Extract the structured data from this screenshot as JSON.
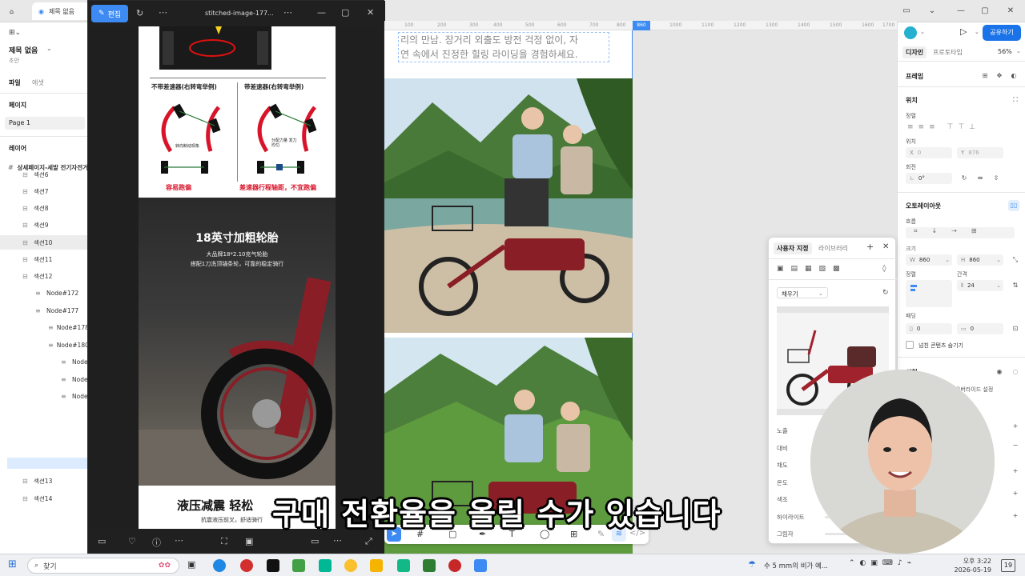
{
  "browser": {
    "home_icon": "home-icon",
    "tab_title": "제목 없음"
  },
  "viewer": {
    "edit_label": "편집",
    "file_name": "stitched-image-177...",
    "image": {
      "diagram_left_title": "不带差速器(右转弯举例)",
      "diagram_right_title": "带差速器(右转弯举例)",
      "diagram_left_inner": "转向制动现象",
      "diagram_right_inner": "分配力量 发力均匀",
      "diagram_left_caption": "容易跑偏",
      "diagram_right_caption": "差速器行程轴距，不宜跑偏",
      "tire_title": "18英寸加粗轮胎",
      "tire_sub1": "大品牌18*2.10充气轮胎",
      "tire_sub2": "搭配1刀洗顶锚条轮，可靠的稳定骑行",
      "bottom_title": "液压减震 轻松",
      "bottom_sub": "抗震液压前叉，舒适骑行"
    }
  },
  "left_panel": {
    "file_title": "제목 없음",
    "file_sub": "초안",
    "tabs": [
      "파일",
      "에셋"
    ],
    "pages_label": "페이지",
    "page_item": "Page 1",
    "layers_label": "레이어",
    "root_layer": "상세페이지-세발 전기자전거",
    "layers": [
      {
        "label": "섹션6",
        "indent": 0
      },
      {
        "label": "섹션7",
        "indent": 0
      },
      {
        "label": "섹션8",
        "indent": 0
      },
      {
        "label": "섹션9",
        "indent": 0
      },
      {
        "label": "섹션10",
        "indent": 0
      },
      {
        "label": "섹션11",
        "indent": 0
      },
      {
        "label": "섹션12",
        "indent": 0
      },
      {
        "label": "Node#172",
        "indent": 1
      },
      {
        "label": "Node#177",
        "indent": 1
      },
      {
        "label": "Node#178",
        "indent": 2
      },
      {
        "label": "Node#180",
        "indent": 2
      },
      {
        "label": "Node",
        "indent": 3
      },
      {
        "label": "Node",
        "indent": 3
      },
      {
        "label": "Node",
        "indent": 3
      },
      {
        "label": "섹션13",
        "indent": 0
      },
      {
        "label": "섹션14",
        "indent": 0
      }
    ]
  },
  "canvas": {
    "ruler_ticks": [
      "100",
      "200",
      "300",
      "400",
      "500",
      "600",
      "700",
      "800",
      "860",
      "1000",
      "1100",
      "1200",
      "1300",
      "1400",
      "1500",
      "1600",
      "1700"
    ],
    "text_line1": "리의 만남. 장거리 외출도 방전 걱정 없이, 자",
    "text_line2": "연 속에서 진정한 힐링 라이딩을 경험하세요."
  },
  "right_panel": {
    "share_label": "공유하기",
    "tabs": [
      "디자인",
      "프로토타입"
    ],
    "zoom": "56%",
    "frame_label": "프레임",
    "position_label": "위치",
    "align_label": "정렬",
    "pos_label": "위치",
    "x_value": "0",
    "y_value": "876",
    "rotation_label": "회전",
    "rotation_value": "0°",
    "autolayout_label": "오토레이아웃",
    "flow_label": "흐름",
    "size_label": "크기",
    "w_value": "860",
    "h_value": "860",
    "align2_label": "정렬",
    "gap_label": "간격",
    "gap_value": "24",
    "padding_label": "패딩",
    "pad_h": "0",
    "pad_v": "0",
    "clip_label": "넘친 콘텐츠 숨기기",
    "appearance_label": "외형",
    "fill_label": "오버라이드 설정"
  },
  "float_panel": {
    "tab_custom": "사용자 지정",
    "tab_library": "라이브러리",
    "fill_select": "채우기",
    "adjustments": [
      "노출",
      "대비",
      "채도",
      "온도",
      "색조",
      "하이라이트",
      "그림자"
    ]
  },
  "subtitle": "구매 전환율을 올릴 수가 있습니다",
  "taskbar": {
    "search_label": "찾기",
    "weather": "수 5 mm의 비가 예...",
    "time": "오후 3:22",
    "date": "2026-05-19",
    "notif": "19"
  },
  "colors": {
    "accent": "#3d8bf2",
    "share_button": "#1a73e8",
    "diagram_red": "#d9142a"
  }
}
